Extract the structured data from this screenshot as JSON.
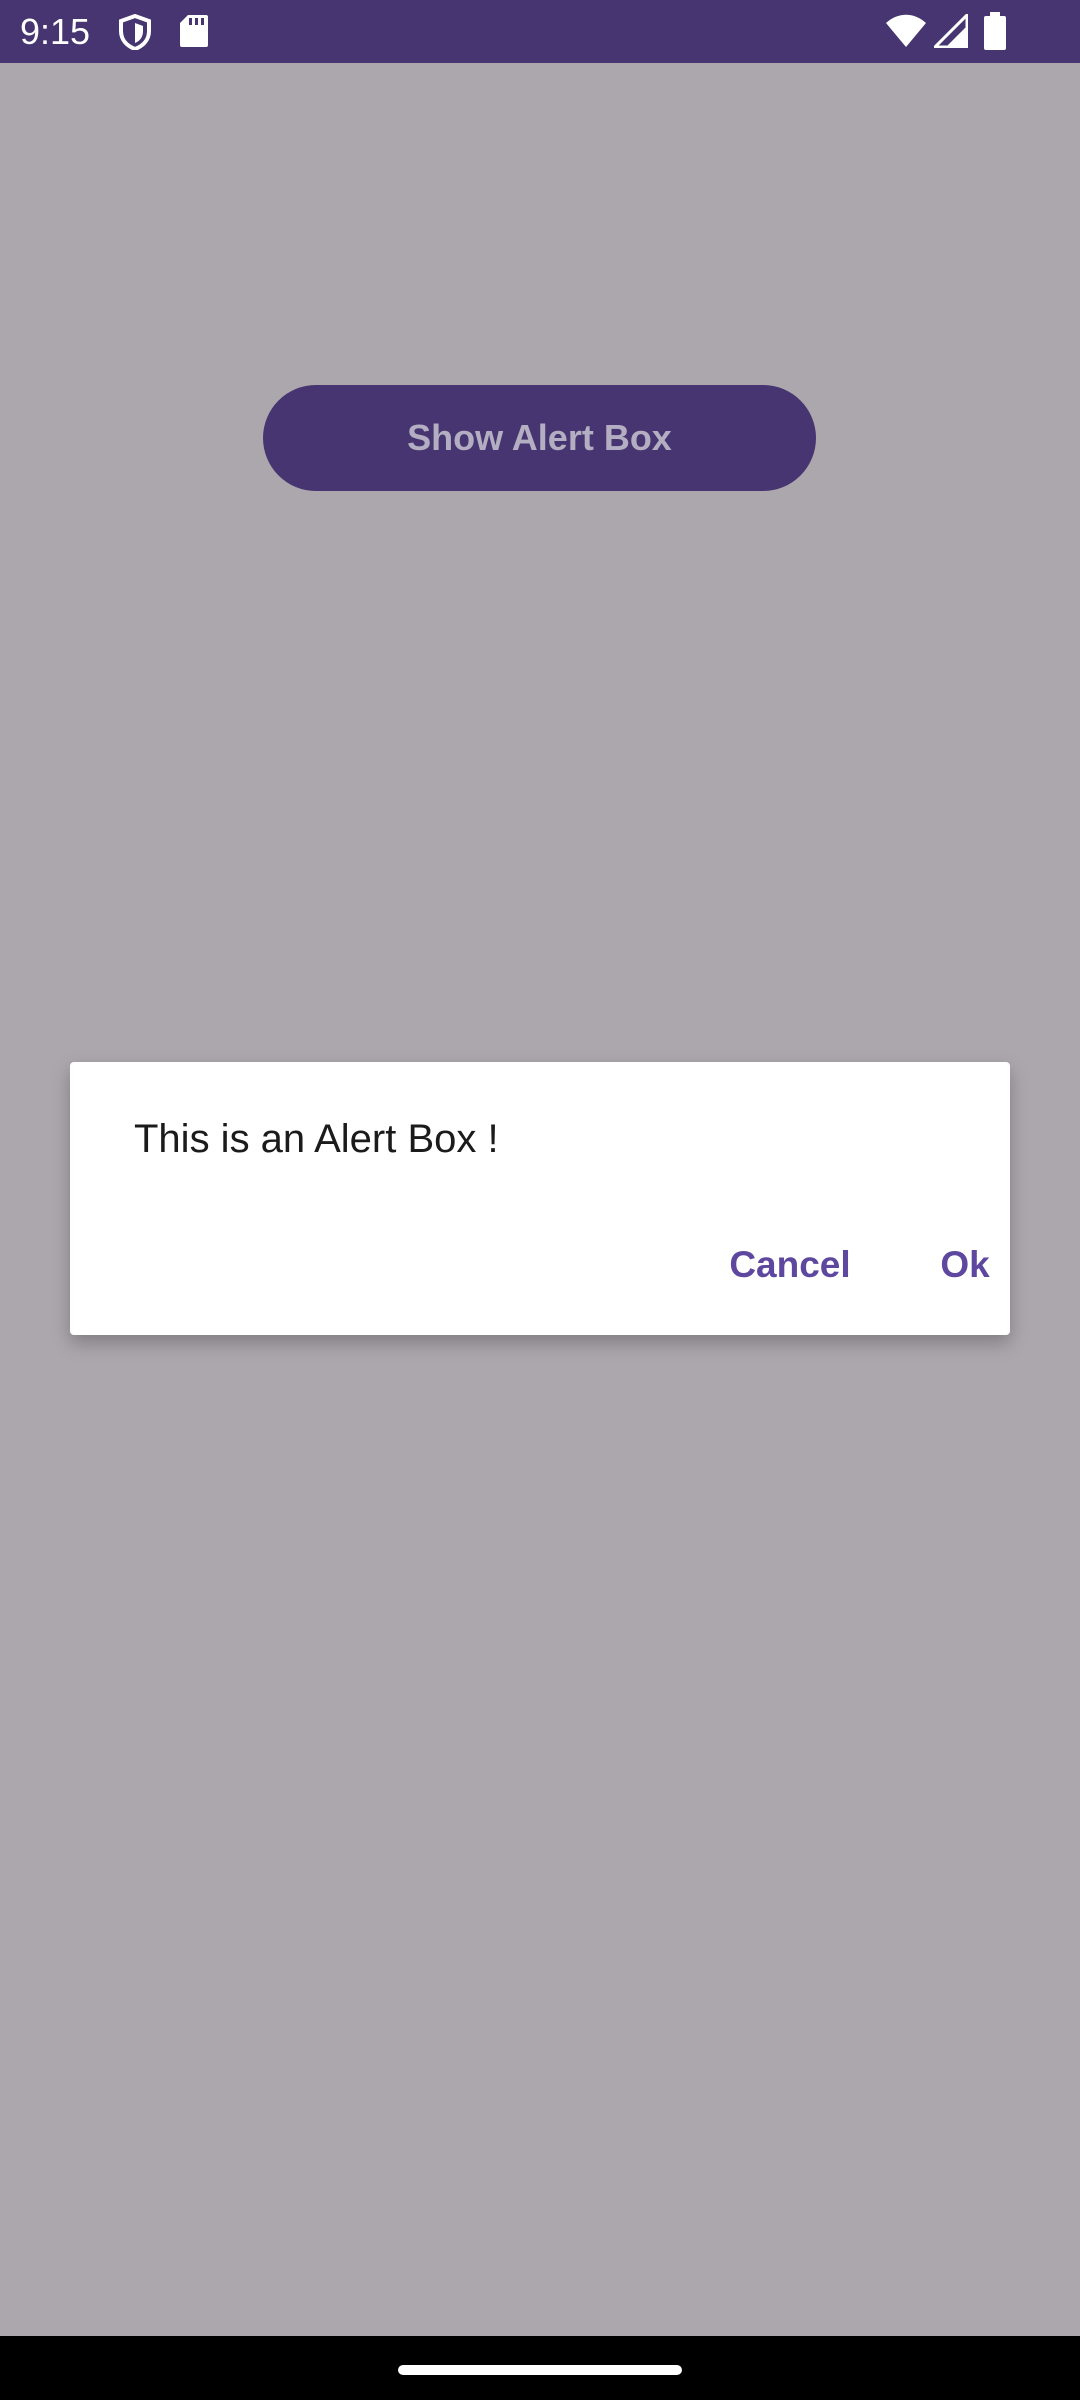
{
  "status_bar": {
    "time": "9:15",
    "icons": [
      "shield-icon",
      "sd-card-icon",
      "wifi-icon",
      "signal-icon",
      "battery-icon"
    ],
    "background": "#463570"
  },
  "main": {
    "show_alert_label": "Show Alert Box",
    "button_color": "#463570",
    "scrim_color": "#aca7ad"
  },
  "dialog": {
    "message": "This is an Alert Box !",
    "cancel_label": "Cancel",
    "ok_label": "Ok",
    "accent_color": "#5d479f"
  },
  "navigation": {
    "handle": "home-handle"
  }
}
